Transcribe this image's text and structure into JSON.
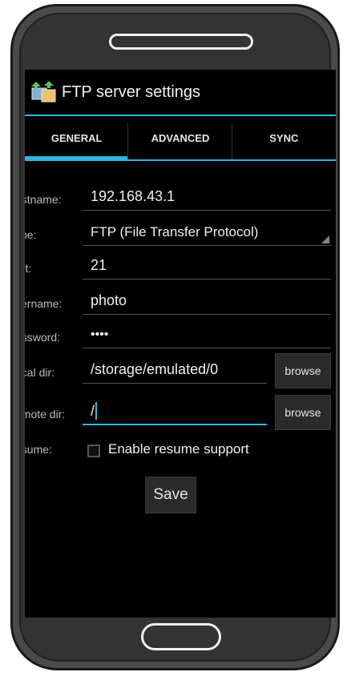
{
  "app": {
    "title": "FTP server settings",
    "icon": "ftp-app-icon"
  },
  "tabs": [
    {
      "label": "GENERAL",
      "active": true
    },
    {
      "label": "ADVANCED",
      "active": false
    },
    {
      "label": "SYNC",
      "active": false
    }
  ],
  "form": {
    "hostname": {
      "label": "ostname:",
      "value": "192.168.43.1"
    },
    "type": {
      "label": "ype:",
      "value": "FTP (File Transfer Protocol)"
    },
    "port": {
      "label": "ort:",
      "value": "21"
    },
    "username": {
      "label": "sername:",
      "value": "photo"
    },
    "password": {
      "label": "assword:",
      "value": "••••"
    },
    "local_dir": {
      "label": "ocal dir:",
      "value": "/storage/emulated/0",
      "button": "browse"
    },
    "remote_dir": {
      "label": "emote dir:",
      "value": "/",
      "button": "browse"
    },
    "resume": {
      "label": "esume:",
      "checkbox_label": "Enable resume support",
      "checked": false
    }
  },
  "save_label": "Save",
  "colors": {
    "accent": "#33b5e5",
    "background": "#000000"
  }
}
